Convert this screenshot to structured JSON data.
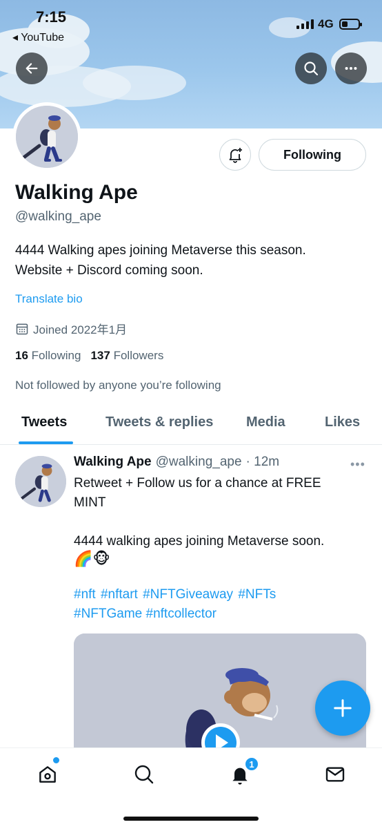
{
  "status_bar": {
    "time": "7:15",
    "back_app": "◂ YouTube",
    "network": "4G"
  },
  "profile": {
    "name": "Walking Ape",
    "handle": "@walking_ape",
    "bio_line1": "4444 Walking apes joining Metaverse this season.",
    "bio_line2": "Website + Discord coming soon.",
    "translate_label": "Translate bio",
    "joined": "Joined 2022年1月",
    "following_count": "16",
    "following_label": "Following",
    "followers_count": "137",
    "followers_label": "Followers",
    "not_followed": "Not followed by anyone you’re following",
    "follow_button_label": "Following"
  },
  "tabs": [
    {
      "label": "Tweets",
      "active": true
    },
    {
      "label": "Tweets & replies",
      "active": false
    },
    {
      "label": "Media",
      "active": false
    },
    {
      "label": "Likes",
      "active": false
    }
  ],
  "tweet": {
    "name": "Walking Ape",
    "handle": "@walking_ape",
    "time": "· 12m",
    "more": "•••",
    "line1": "Retweet + Follow us for a chance at FREE",
    "line2": "MINT",
    "line3": "4444 walking apes joining Metaverse soon.",
    "emoji": "🌈🐵",
    "tags1": "#nft #nftart #NFTGiveaway  #NFTs",
    "tags2": "#NFTGame #nftcollector"
  },
  "bottom_nav": {
    "notification_badge": "1"
  },
  "colors": {
    "accent": "#1d9bf0",
    "text": "#0f1419",
    "muted": "#536471",
    "banner": "#9cc7ec"
  }
}
